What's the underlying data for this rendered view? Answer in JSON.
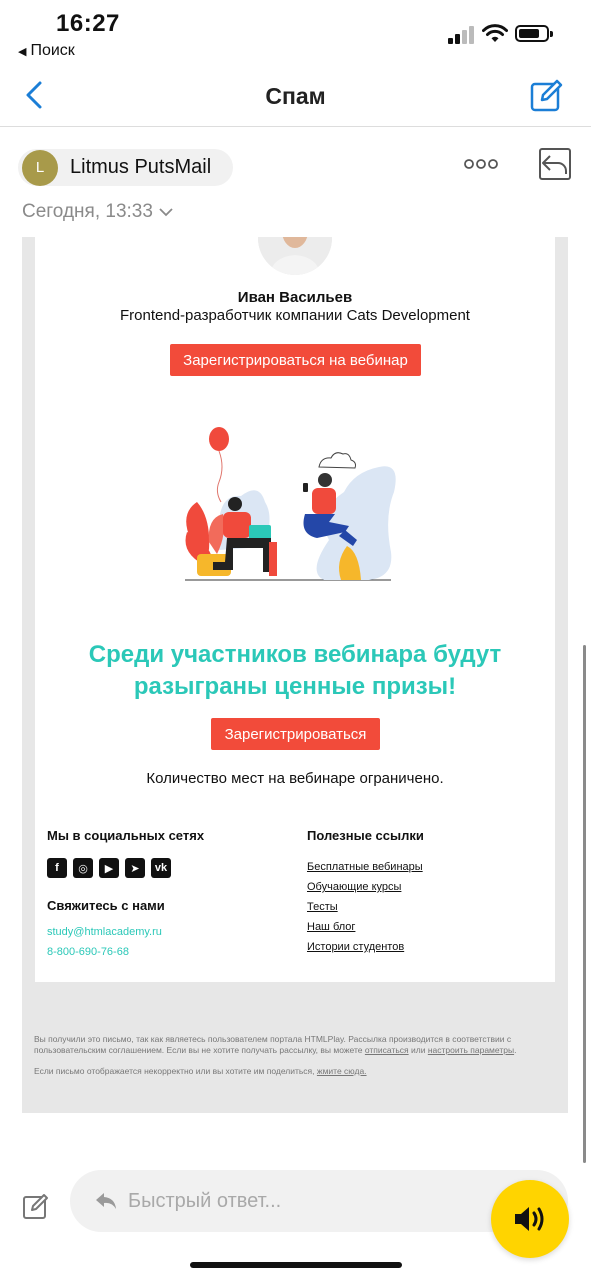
{
  "status_bar": {
    "time": "16:27",
    "back_app_label": "Поиск"
  },
  "nav": {
    "title": "Спам"
  },
  "message": {
    "avatar_letter": "L",
    "sender": "Litmus PutsMail",
    "date": "Сегодня, 13:33"
  },
  "email": {
    "speaker_name": "Иван Васильев",
    "speaker_role": "Frontend-разработчик компании Cats Development",
    "webinar_button": "Зарегистрироваться на вебинар",
    "prize_line1": "Среди участников вебинара будут",
    "prize_line2": "разыграны ценные призы!",
    "register_button": "Зарегистрироваться",
    "limited": "Количество мест на вебинаре ограничено.",
    "social_heading": "Мы в социальных сетях",
    "social_icons": [
      {
        "name": "facebook-icon",
        "glyph": "f"
      },
      {
        "name": "instagram-icon",
        "glyph": "◎"
      },
      {
        "name": "youtube-icon",
        "glyph": "▶"
      },
      {
        "name": "telegram-icon",
        "glyph": "➤"
      },
      {
        "name": "vk-icon",
        "glyph": "vk"
      }
    ],
    "contact_heading": "Свяжитесь с нами",
    "email_address": "study@htmlacademy.ru",
    "phone": "8-800-690-76-68",
    "useful_heading": "Полезные ссылки",
    "useful_links": [
      "Бесплатные вебинары",
      "Обучающие курсы",
      "Тесты",
      "Наш блог",
      "Истории студентов"
    ],
    "legal_text_1": "Вы получили это письмо, так как являетесь пользователем портала HTMLPlay. Рассылка производится в соответствии с пользовательским соглашением. Если вы не хотите получать рассылку, вы можете ",
    "legal_unsubscribe": "отписаться",
    "legal_or": " или ",
    "legal_settings": "настроить параметры",
    "legal_end": ".",
    "legal_text_2": "Если письмо отображается некорректно или вы хотите им поделиться, ",
    "legal_here": "жмите сюда."
  },
  "quick_reply": {
    "placeholder": "Быстрый ответ..."
  },
  "colors": {
    "accent_blue": "#1b7ed6",
    "button_red": "#f24b3a",
    "teal": "#2bc8b8",
    "voice_yellow": "#ffd400"
  }
}
